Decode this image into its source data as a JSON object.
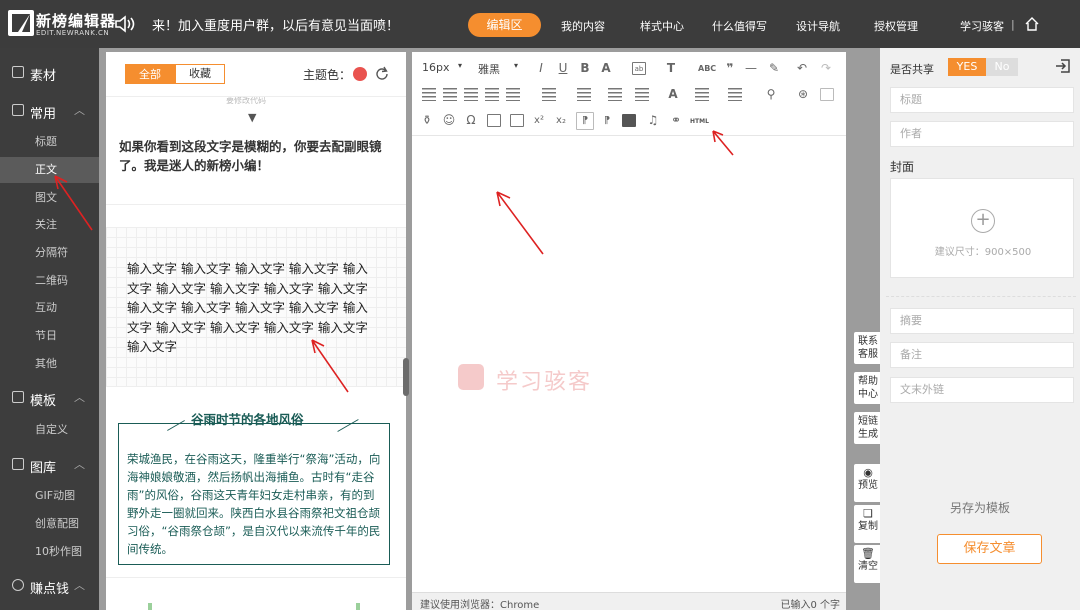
{
  "header": {
    "logo_text": "新榜编辑器",
    "logo_sub": "EDIT.NEWRANK.CN",
    "announcement": "来！加入重度用户群，以后有意见当面喷！",
    "nav": [
      "编辑区",
      "我的内容",
      "样式中心",
      "什么值得写",
      "设计导航",
      "授权管理",
      "学习骇客"
    ],
    "separator": "|"
  },
  "sidebar": {
    "sections": [
      {
        "label": "素材",
        "icon": "book-icon"
      },
      {
        "label": "常用",
        "icon": "layers-icon",
        "chevron": "︿"
      },
      {
        "label": "模板",
        "icon": "file-icon",
        "chevron": "︿"
      },
      {
        "label": "图库",
        "icon": "image-icon",
        "chevron": "︿"
      },
      {
        "label": "赚点钱",
        "icon": "coin-icon",
        "chevron": "︿"
      }
    ],
    "common_items": [
      "标题",
      "正文",
      "图文",
      "关注",
      "分隔符",
      "二维码",
      "互动",
      "节日",
      "其他"
    ],
    "template_items": [
      "自定义"
    ],
    "gallery_items": [
      "GIF动图",
      "创意配图",
      "10秒作图"
    ],
    "active_item": "正文"
  },
  "panel": {
    "tabs": [
      "全部",
      "收藏"
    ],
    "theme_label": "主题色：",
    "theme_color": "#e9534f",
    "tmpl1_faint": "要修改代码",
    "tmpl1_text": "如果你看到这段文字是模糊的，你要去配副眼镜了。我是迷人的新榜小编！",
    "tmpl2_text": "输入文字 输入文字 输入文字 输入文字 输入文字 输入文字 输入文字 输入文字 输入文字 输入文字 输入文字 输入文字 输入文字 输入文字 输入文字 输入文字 输入文字 输入文字 输入文字",
    "tmpl3_title": "谷雨时节的各地风俗",
    "tmpl3_text": "荣城渔民，在谷雨这天，隆重举行“祭海”活动，向海神娘娘敬酒，然后扬帆出海捕鱼。古时有“走谷雨”的风俗，谷雨这天青年妇女走村串亲，有的到野外走一圈就回来。陕西白水县谷雨祭祀文祖仓颉习俗，“谷雨祭仓颉”，是自汉代以来流传千年的民间传统。"
  },
  "editor": {
    "font_size": "16px",
    "font_family": "雅黑",
    "html_label": "HTML",
    "watermark": "学习骇客",
    "status_left": "建议使用浏览器：Chrome",
    "status_right": "已输入0 个字"
  },
  "float_buttons": [
    "联系客服",
    "帮助中心",
    "短链生成",
    "预览",
    "复制",
    "清空"
  ],
  "right_panel": {
    "share_label": "是否共享",
    "yes": "YES",
    "no": "No",
    "title_placeholder": "标题",
    "author_placeholder": "作者",
    "cover_label": "封面",
    "cover_hint": "建议尺寸：900×500",
    "summary_placeholder": "摘要",
    "note_placeholder": "备注",
    "link_placeholder": "文末外链",
    "save_template": "另存为模板",
    "save_article": "保存文章"
  },
  "colors": {
    "accent": "#f58e2f",
    "dark": "#3c3c3c",
    "teal": "#1a5c56",
    "annotation": "#d22"
  }
}
